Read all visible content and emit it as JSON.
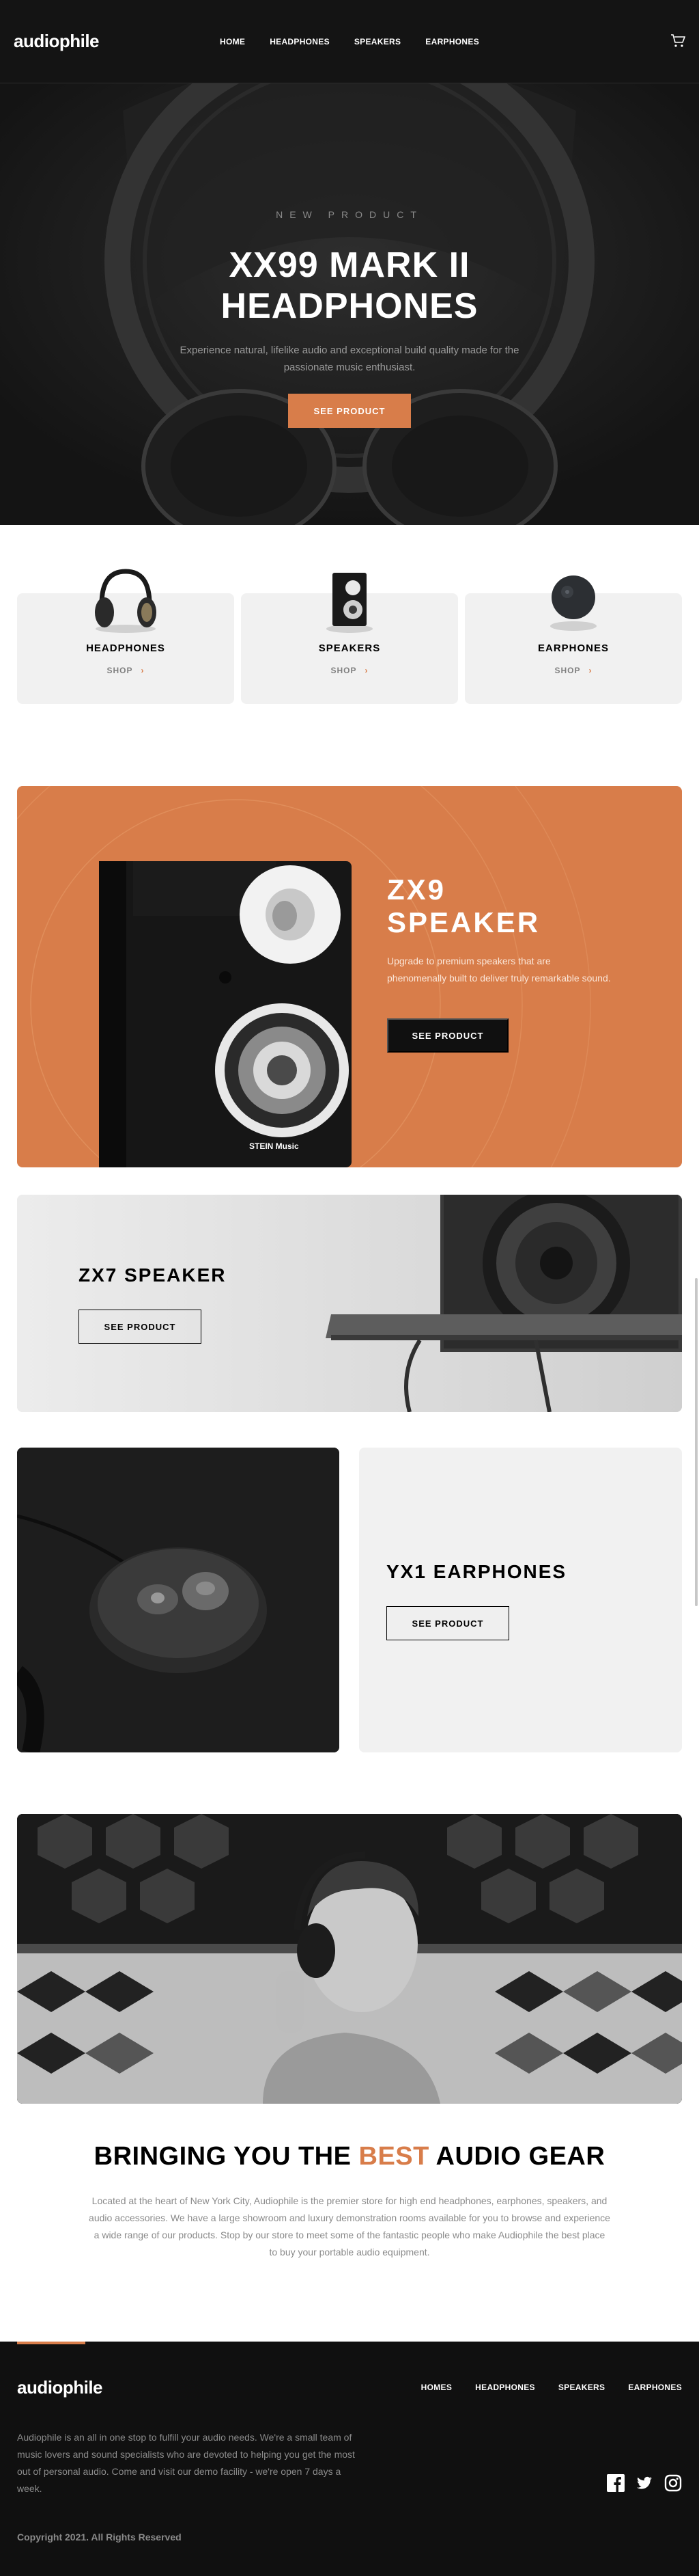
{
  "header": {
    "logo": "audiophile",
    "nav": [
      "HOME",
      "HEADPHONES",
      "SPEAKERS",
      "EARPHONES"
    ]
  },
  "hero": {
    "overline": "NEW PRODUCT",
    "title_line1": "XX99 MARK II",
    "title_line2": "HEADPHONES",
    "desc_line1": "Experience natural, lifelike audio and exceptional build quality made for the",
    "desc_line2": "passionate music enthusiast.",
    "button": "SEE PRODUCT"
  },
  "categories": [
    {
      "name": "HEADPHONES",
      "shop": "SHOP",
      "icon": "headphones-icon"
    },
    {
      "name": "SPEAKERS",
      "shop": "SHOP",
      "icon": "speaker-icon"
    },
    {
      "name": "EARPHONES",
      "shop": "SHOP",
      "icon": "earphones-icon"
    }
  ],
  "zx9": {
    "title_line1": "ZX9",
    "title_line2": "SPEAKER",
    "desc": "Upgrade to premium speakers that are phenomenally built to deliver truly remarkable sound.",
    "button": "SEE PRODUCT",
    "brand_mark": "STEIN Music"
  },
  "zx7": {
    "title": "ZX7 SPEAKER",
    "button": "SEE PRODUCT"
  },
  "yx1": {
    "title": "YX1 EARPHONES",
    "button": "SEE PRODUCT"
  },
  "about": {
    "title_pre": "BRINGING YOU THE ",
    "title_accent": "BEST",
    "title_post": " AUDIO GEAR",
    "desc": "Located at the heart of New York City, Audiophile is the premier store for high end headphones, earphones, speakers, and audio accessories. We have a large showroom and luxury demonstration rooms available for you to browse and experience a wide range of our products. Stop by our store to meet some of the fantastic people who make Audiophile the best place to buy your portable audio equipment."
  },
  "footer": {
    "logo": "audiophile",
    "nav": [
      "HOMES",
      "HEADPHONES",
      "SPEAKERS",
      "EARPHONES"
    ],
    "desc": "Audiophile is an all in one stop to fulfill your audio needs. We're a small team of music lovers and sound specialists who are devoted to helping you get the most out of personal audio. Come and visit our demo facility - we're open 7 days a week.",
    "copyright": "Copyright 2021. All Rights Reserved",
    "social": [
      "facebook-icon",
      "twitter-icon",
      "instagram-icon"
    ]
  },
  "colors": {
    "accent": "#d87d4a",
    "dark": "#101010",
    "light_card": "#f1f1f1"
  }
}
